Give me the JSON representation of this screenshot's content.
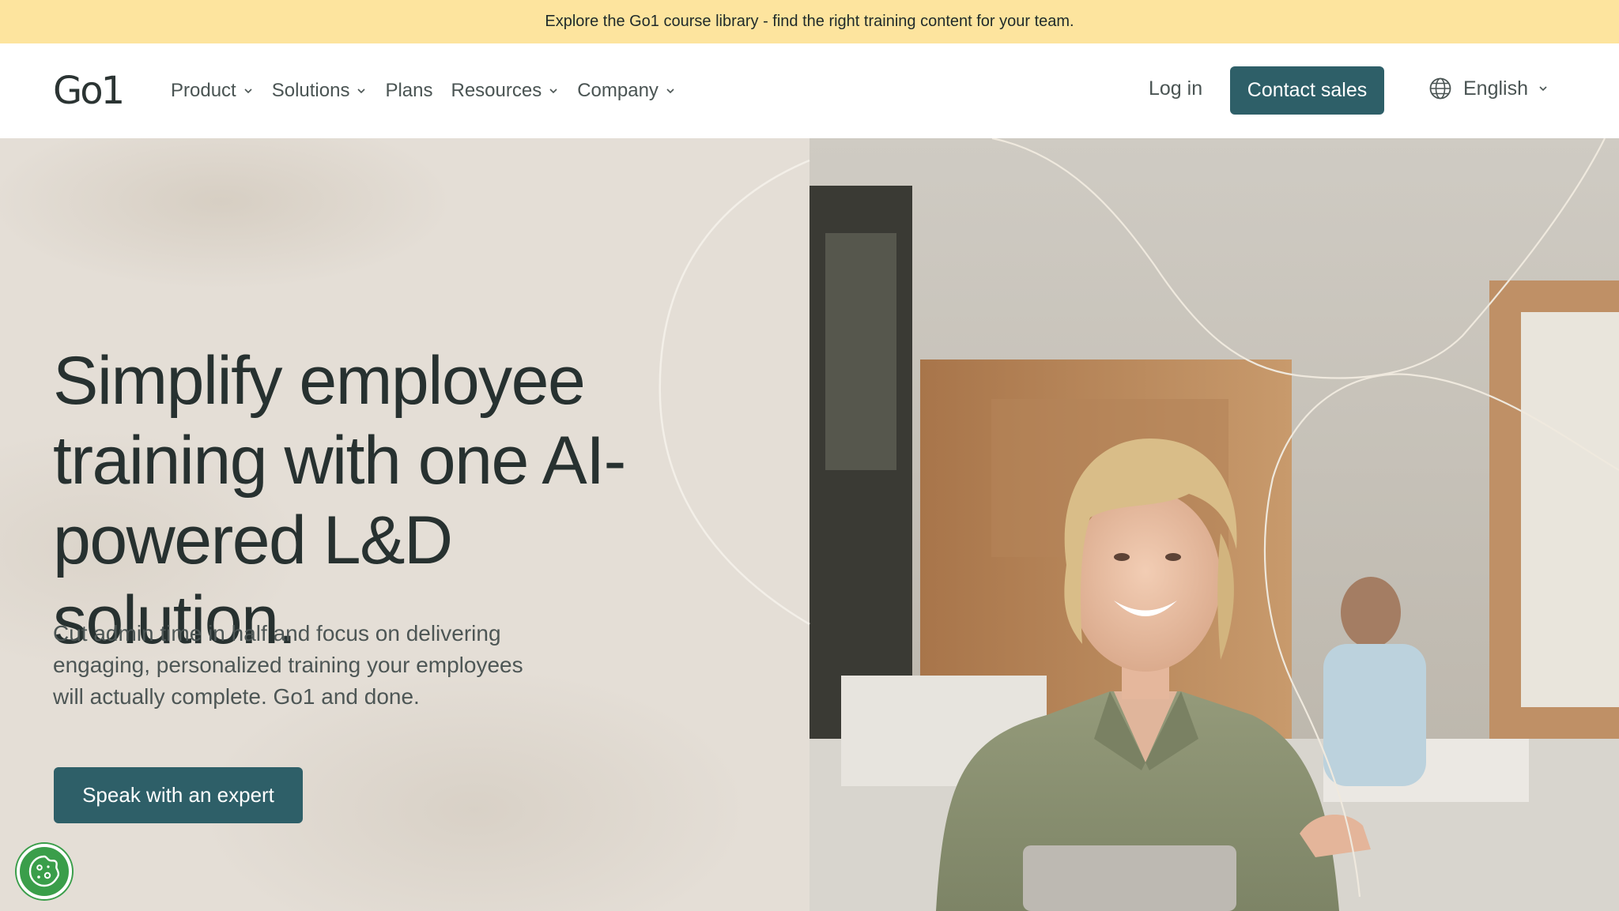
{
  "banner": {
    "text": "Explore the Go1 course library - find the right training content for your team."
  },
  "header": {
    "logo": "Go1",
    "nav": [
      {
        "label": "Product",
        "dropdown": true
      },
      {
        "label": "Solutions",
        "dropdown": true
      },
      {
        "label": "Plans",
        "dropdown": false
      },
      {
        "label": "Resources",
        "dropdown": true
      },
      {
        "label": "Company",
        "dropdown": true
      }
    ],
    "login_label": "Log in",
    "contact_label": "Contact sales",
    "language_label": "English"
  },
  "hero": {
    "headline_line1": "Simplify employee",
    "headline_line2": "training with one AI-",
    "headline_line3": "powered L&D solution.",
    "sub_line1": "Cut admin time in half and focus on delivering",
    "sub_line2": "engaging, personalized training your employees",
    "sub_line3": "will actually complete. Go1 and done.",
    "cta_label": "Speak with an expert"
  },
  "colors": {
    "banner_bg": "#fde49e",
    "primary": "#2e5f68",
    "hero_left_bg": "#e4ded6",
    "cookie_green": "#3a9e4a"
  },
  "icons": {
    "dropdown": "chevron-down-icon",
    "language": "globe-icon",
    "cookie": "cookie-icon"
  }
}
